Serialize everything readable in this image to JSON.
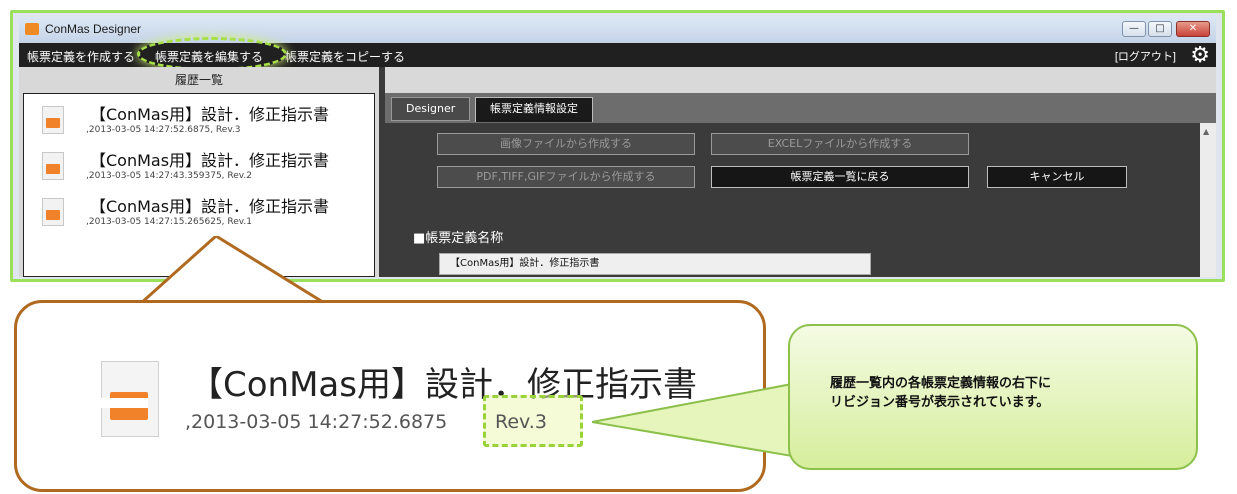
{
  "window": {
    "title": "ConMas Designer"
  },
  "menu": {
    "create": "帳票定義を作成する",
    "edit": "帳票定義を編集する",
    "copy": "帳票定義をコピーする",
    "logout": "[ログアウト]"
  },
  "history": {
    "header": "履歴一覧",
    "items": [
      {
        "title": "【ConMas用】設計．修正指示書",
        "meta": ",2013-03-05 14:27:52.6875, Rev.3"
      },
      {
        "title": "【ConMas用】設計．修正指示書",
        "meta": ",2013-03-05 14:27:43.359375, Rev.2"
      },
      {
        "title": "【ConMas用】設計．修正指示書",
        "meta": ",2013-03-05 14:27:15.265625, Rev.1"
      }
    ]
  },
  "tabs": [
    "Designer",
    "帳票定義情報設定"
  ],
  "buttons": {
    "from_image": "画像ファイルから作成する",
    "from_excel": "EXCELファイルから作成する",
    "from_pdf": "PDF,TIFF,GIFファイルから作成する",
    "back_to_list": "帳票定義一覧に戻る",
    "cancel": "キャンセル"
  },
  "section": {
    "label": "■帳票定義名称",
    "name_value": "【ConMas用】設計．修正指示書"
  },
  "zoom": {
    "title": "【ConMas用】設計．修正指示書",
    "meta": ",2013-03-05 14:27:52.6875",
    "rev": "Rev.3"
  },
  "annotation": {
    "line1": "履歴一覧内の各帳票定義情報の右下に",
    "line2": "リビジョン番号が表示されています。"
  },
  "colors": {
    "highlight": "#a8e048",
    "callout_border": "#b06a20",
    "bubble": "#d6ee9c"
  },
  "icons": [
    "app-icon",
    "minimize-icon",
    "maximize-icon",
    "close-icon",
    "gear-icon",
    "document-icon",
    "scroll-up-icon"
  ]
}
